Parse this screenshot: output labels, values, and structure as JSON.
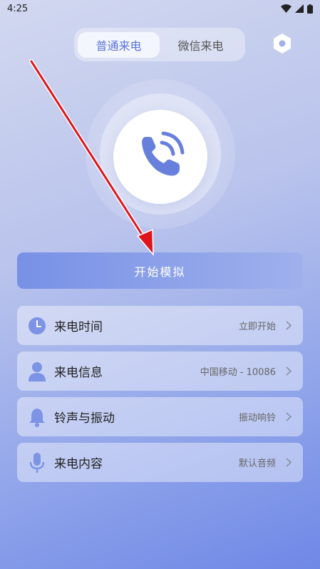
{
  "status_bar": {
    "time": "4:25",
    "icons": [
      "wifi-icon",
      "signal-icon",
      "battery-icon"
    ]
  },
  "tabs": [
    {
      "label": "普通来电",
      "active": true
    },
    {
      "label": "微信来电",
      "active": false
    }
  ],
  "settings_icon": "settings-icon",
  "hero_icon": "phone-ringing-icon",
  "start_button": {
    "label": "开始模拟"
  },
  "settings_list": [
    {
      "icon": "clock-icon",
      "label": "来电时间",
      "value": "立即开始"
    },
    {
      "icon": "person-icon",
      "label": "来电信息",
      "value": "中国移动 - 10086"
    },
    {
      "icon": "bell-icon",
      "label": "铃声与振动",
      "value": "振动响铃"
    },
    {
      "icon": "microphone-icon",
      "label": "来电内容",
      "value": "默认音频"
    }
  ],
  "colors": {
    "accent": "#5c74d8",
    "icon": "#7c93e6",
    "annotation_arrow": "#e0141b"
  }
}
